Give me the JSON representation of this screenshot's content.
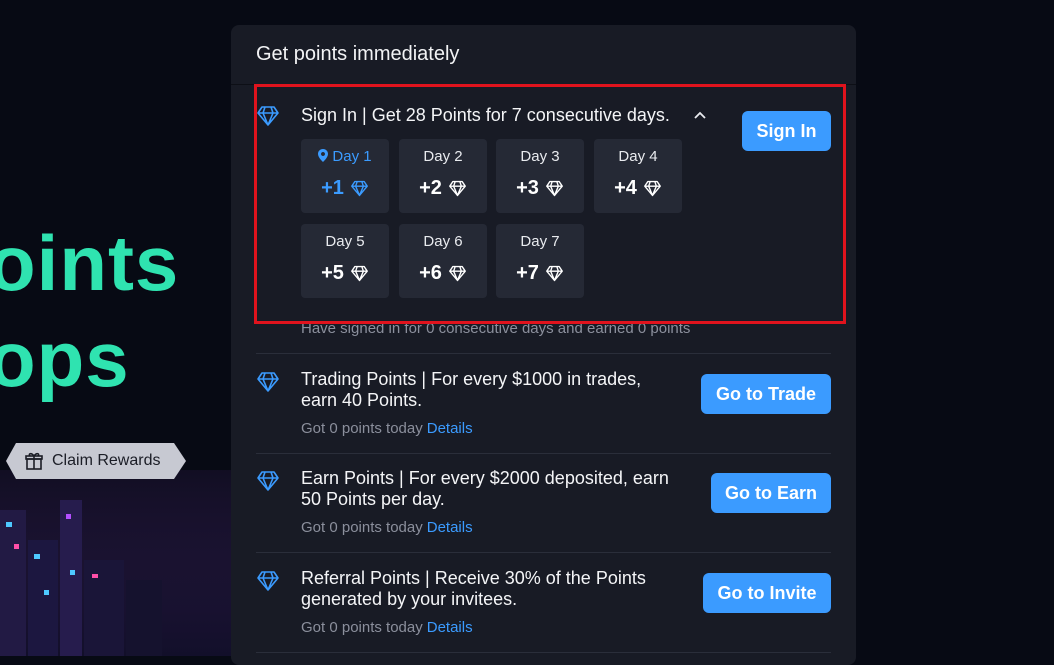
{
  "hero": {
    "line1": "oints",
    "line2": "ops",
    "claim_label": "Claim Rewards",
    "claim_icon": "gift-icon"
  },
  "panel": {
    "title": "Get points immediately",
    "sign_in": {
      "title": "Sign In | Get 28 Points for 7 consecutive days.",
      "button": "Sign In",
      "caret_icon": "chevron-up-icon",
      "status": "Have signed in for 0 consecutive days and earned 0 points",
      "days": [
        {
          "label": "Day 1",
          "value": "+1",
          "current": true
        },
        {
          "label": "Day 2",
          "value": "+2",
          "current": false
        },
        {
          "label": "Day 3",
          "value": "+3",
          "current": false
        },
        {
          "label": "Day 4",
          "value": "+4",
          "current": false
        },
        {
          "label": "Day 5",
          "value": "+5",
          "current": false
        },
        {
          "label": "Day 6",
          "value": "+6",
          "current": false
        },
        {
          "label": "Day 7",
          "value": "+7",
          "current": false
        }
      ]
    },
    "tasks": [
      {
        "line1": "Trading Points | For every $1000 in trades,",
        "line2": "earn 40 Points.",
        "status": "Got 0 points today",
        "details": "Details",
        "button": "Go to Trade"
      },
      {
        "line1": "Earn Points | For every $2000 deposited, earn",
        "line2": "50 Points per day.",
        "status": "Got 0 points today",
        "details": "Details",
        "button": "Go to Earn"
      },
      {
        "line1": "Referral Points | Receive 30% of the Points",
        "line2": "generated by your invitees.",
        "status": "Got 0 points today",
        "details": "Details",
        "button": "Go to Invite"
      }
    ]
  },
  "colors": {
    "accent": "#3b9bff",
    "hero_text": "#2fe3b0",
    "panel_bg": "#181b25",
    "tile_bg": "#252935",
    "highlight": "#e0131d"
  }
}
